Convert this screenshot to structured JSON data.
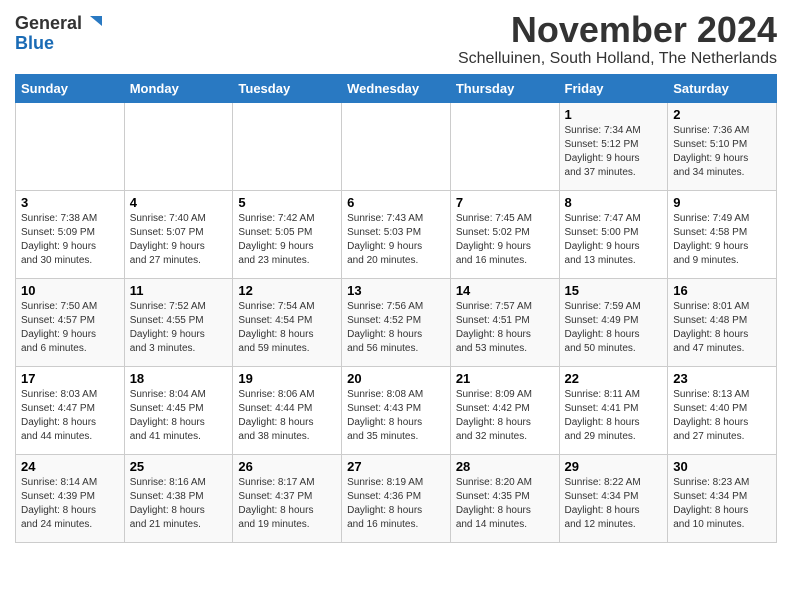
{
  "logo": {
    "line1": "General",
    "line2": "Blue"
  },
  "title": "November 2024",
  "subtitle": "Schelluinen, South Holland, The Netherlands",
  "weekdays": [
    "Sunday",
    "Monday",
    "Tuesday",
    "Wednesday",
    "Thursday",
    "Friday",
    "Saturday"
  ],
  "weeks": [
    [
      {
        "day": "",
        "info": ""
      },
      {
        "day": "",
        "info": ""
      },
      {
        "day": "",
        "info": ""
      },
      {
        "day": "",
        "info": ""
      },
      {
        "day": "",
        "info": ""
      },
      {
        "day": "1",
        "info": "Sunrise: 7:34 AM\nSunset: 5:12 PM\nDaylight: 9 hours\nand 37 minutes."
      },
      {
        "day": "2",
        "info": "Sunrise: 7:36 AM\nSunset: 5:10 PM\nDaylight: 9 hours\nand 34 minutes."
      }
    ],
    [
      {
        "day": "3",
        "info": "Sunrise: 7:38 AM\nSunset: 5:09 PM\nDaylight: 9 hours\nand 30 minutes."
      },
      {
        "day": "4",
        "info": "Sunrise: 7:40 AM\nSunset: 5:07 PM\nDaylight: 9 hours\nand 27 minutes."
      },
      {
        "day": "5",
        "info": "Sunrise: 7:42 AM\nSunset: 5:05 PM\nDaylight: 9 hours\nand 23 minutes."
      },
      {
        "day": "6",
        "info": "Sunrise: 7:43 AM\nSunset: 5:03 PM\nDaylight: 9 hours\nand 20 minutes."
      },
      {
        "day": "7",
        "info": "Sunrise: 7:45 AM\nSunset: 5:02 PM\nDaylight: 9 hours\nand 16 minutes."
      },
      {
        "day": "8",
        "info": "Sunrise: 7:47 AM\nSunset: 5:00 PM\nDaylight: 9 hours\nand 13 minutes."
      },
      {
        "day": "9",
        "info": "Sunrise: 7:49 AM\nSunset: 4:58 PM\nDaylight: 9 hours\nand 9 minutes."
      }
    ],
    [
      {
        "day": "10",
        "info": "Sunrise: 7:50 AM\nSunset: 4:57 PM\nDaylight: 9 hours\nand 6 minutes."
      },
      {
        "day": "11",
        "info": "Sunrise: 7:52 AM\nSunset: 4:55 PM\nDaylight: 9 hours\nand 3 minutes."
      },
      {
        "day": "12",
        "info": "Sunrise: 7:54 AM\nSunset: 4:54 PM\nDaylight: 8 hours\nand 59 minutes."
      },
      {
        "day": "13",
        "info": "Sunrise: 7:56 AM\nSunset: 4:52 PM\nDaylight: 8 hours\nand 56 minutes."
      },
      {
        "day": "14",
        "info": "Sunrise: 7:57 AM\nSunset: 4:51 PM\nDaylight: 8 hours\nand 53 minutes."
      },
      {
        "day": "15",
        "info": "Sunrise: 7:59 AM\nSunset: 4:49 PM\nDaylight: 8 hours\nand 50 minutes."
      },
      {
        "day": "16",
        "info": "Sunrise: 8:01 AM\nSunset: 4:48 PM\nDaylight: 8 hours\nand 47 minutes."
      }
    ],
    [
      {
        "day": "17",
        "info": "Sunrise: 8:03 AM\nSunset: 4:47 PM\nDaylight: 8 hours\nand 44 minutes."
      },
      {
        "day": "18",
        "info": "Sunrise: 8:04 AM\nSunset: 4:45 PM\nDaylight: 8 hours\nand 41 minutes."
      },
      {
        "day": "19",
        "info": "Sunrise: 8:06 AM\nSunset: 4:44 PM\nDaylight: 8 hours\nand 38 minutes."
      },
      {
        "day": "20",
        "info": "Sunrise: 8:08 AM\nSunset: 4:43 PM\nDaylight: 8 hours\nand 35 minutes."
      },
      {
        "day": "21",
        "info": "Sunrise: 8:09 AM\nSunset: 4:42 PM\nDaylight: 8 hours\nand 32 minutes."
      },
      {
        "day": "22",
        "info": "Sunrise: 8:11 AM\nSunset: 4:41 PM\nDaylight: 8 hours\nand 29 minutes."
      },
      {
        "day": "23",
        "info": "Sunrise: 8:13 AM\nSunset: 4:40 PM\nDaylight: 8 hours\nand 27 minutes."
      }
    ],
    [
      {
        "day": "24",
        "info": "Sunrise: 8:14 AM\nSunset: 4:39 PM\nDaylight: 8 hours\nand 24 minutes."
      },
      {
        "day": "25",
        "info": "Sunrise: 8:16 AM\nSunset: 4:38 PM\nDaylight: 8 hours\nand 21 minutes."
      },
      {
        "day": "26",
        "info": "Sunrise: 8:17 AM\nSunset: 4:37 PM\nDaylight: 8 hours\nand 19 minutes."
      },
      {
        "day": "27",
        "info": "Sunrise: 8:19 AM\nSunset: 4:36 PM\nDaylight: 8 hours\nand 16 minutes."
      },
      {
        "day": "28",
        "info": "Sunrise: 8:20 AM\nSunset: 4:35 PM\nDaylight: 8 hours\nand 14 minutes."
      },
      {
        "day": "29",
        "info": "Sunrise: 8:22 AM\nSunset: 4:34 PM\nDaylight: 8 hours\nand 12 minutes."
      },
      {
        "day": "30",
        "info": "Sunrise: 8:23 AM\nSunset: 4:34 PM\nDaylight: 8 hours\nand 10 minutes."
      }
    ]
  ]
}
